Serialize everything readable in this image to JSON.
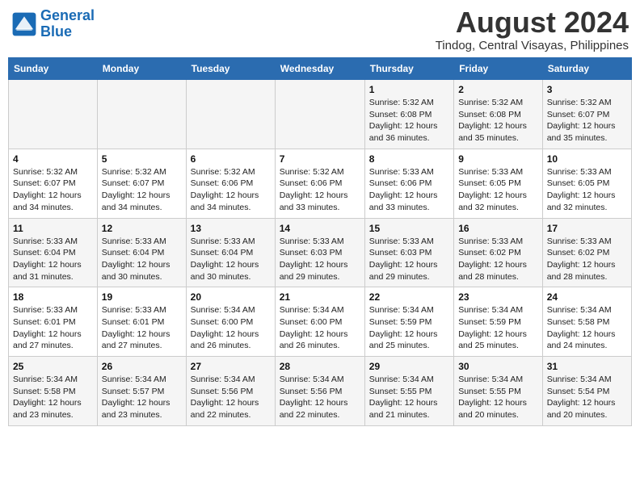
{
  "header": {
    "logo_line1": "General",
    "logo_line2": "Blue",
    "month_year": "August 2024",
    "location": "Tindog, Central Visayas, Philippines"
  },
  "weekdays": [
    "Sunday",
    "Monday",
    "Tuesday",
    "Wednesday",
    "Thursday",
    "Friday",
    "Saturday"
  ],
  "weeks": [
    [
      {
        "day": "",
        "detail": ""
      },
      {
        "day": "",
        "detail": ""
      },
      {
        "day": "",
        "detail": ""
      },
      {
        "day": "",
        "detail": ""
      },
      {
        "day": "1",
        "detail": "Sunrise: 5:32 AM\nSunset: 6:08 PM\nDaylight: 12 hours and 36 minutes."
      },
      {
        "day": "2",
        "detail": "Sunrise: 5:32 AM\nSunset: 6:08 PM\nDaylight: 12 hours and 35 minutes."
      },
      {
        "day": "3",
        "detail": "Sunrise: 5:32 AM\nSunset: 6:07 PM\nDaylight: 12 hours and 35 minutes."
      }
    ],
    [
      {
        "day": "4",
        "detail": "Sunrise: 5:32 AM\nSunset: 6:07 PM\nDaylight: 12 hours and 34 minutes."
      },
      {
        "day": "5",
        "detail": "Sunrise: 5:32 AM\nSunset: 6:07 PM\nDaylight: 12 hours and 34 minutes."
      },
      {
        "day": "6",
        "detail": "Sunrise: 5:32 AM\nSunset: 6:06 PM\nDaylight: 12 hours and 34 minutes."
      },
      {
        "day": "7",
        "detail": "Sunrise: 5:32 AM\nSunset: 6:06 PM\nDaylight: 12 hours and 33 minutes."
      },
      {
        "day": "8",
        "detail": "Sunrise: 5:33 AM\nSunset: 6:06 PM\nDaylight: 12 hours and 33 minutes."
      },
      {
        "day": "9",
        "detail": "Sunrise: 5:33 AM\nSunset: 6:05 PM\nDaylight: 12 hours and 32 minutes."
      },
      {
        "day": "10",
        "detail": "Sunrise: 5:33 AM\nSunset: 6:05 PM\nDaylight: 12 hours and 32 minutes."
      }
    ],
    [
      {
        "day": "11",
        "detail": "Sunrise: 5:33 AM\nSunset: 6:04 PM\nDaylight: 12 hours and 31 minutes."
      },
      {
        "day": "12",
        "detail": "Sunrise: 5:33 AM\nSunset: 6:04 PM\nDaylight: 12 hours and 30 minutes."
      },
      {
        "day": "13",
        "detail": "Sunrise: 5:33 AM\nSunset: 6:04 PM\nDaylight: 12 hours and 30 minutes."
      },
      {
        "day": "14",
        "detail": "Sunrise: 5:33 AM\nSunset: 6:03 PM\nDaylight: 12 hours and 29 minutes."
      },
      {
        "day": "15",
        "detail": "Sunrise: 5:33 AM\nSunset: 6:03 PM\nDaylight: 12 hours and 29 minutes."
      },
      {
        "day": "16",
        "detail": "Sunrise: 5:33 AM\nSunset: 6:02 PM\nDaylight: 12 hours and 28 minutes."
      },
      {
        "day": "17",
        "detail": "Sunrise: 5:33 AM\nSunset: 6:02 PM\nDaylight: 12 hours and 28 minutes."
      }
    ],
    [
      {
        "day": "18",
        "detail": "Sunrise: 5:33 AM\nSunset: 6:01 PM\nDaylight: 12 hours and 27 minutes."
      },
      {
        "day": "19",
        "detail": "Sunrise: 5:33 AM\nSunset: 6:01 PM\nDaylight: 12 hours and 27 minutes."
      },
      {
        "day": "20",
        "detail": "Sunrise: 5:34 AM\nSunset: 6:00 PM\nDaylight: 12 hours and 26 minutes."
      },
      {
        "day": "21",
        "detail": "Sunrise: 5:34 AM\nSunset: 6:00 PM\nDaylight: 12 hours and 26 minutes."
      },
      {
        "day": "22",
        "detail": "Sunrise: 5:34 AM\nSunset: 5:59 PM\nDaylight: 12 hours and 25 minutes."
      },
      {
        "day": "23",
        "detail": "Sunrise: 5:34 AM\nSunset: 5:59 PM\nDaylight: 12 hours and 25 minutes."
      },
      {
        "day": "24",
        "detail": "Sunrise: 5:34 AM\nSunset: 5:58 PM\nDaylight: 12 hours and 24 minutes."
      }
    ],
    [
      {
        "day": "25",
        "detail": "Sunrise: 5:34 AM\nSunset: 5:58 PM\nDaylight: 12 hours and 23 minutes."
      },
      {
        "day": "26",
        "detail": "Sunrise: 5:34 AM\nSunset: 5:57 PM\nDaylight: 12 hours and 23 minutes."
      },
      {
        "day": "27",
        "detail": "Sunrise: 5:34 AM\nSunset: 5:56 PM\nDaylight: 12 hours and 22 minutes."
      },
      {
        "day": "28",
        "detail": "Sunrise: 5:34 AM\nSunset: 5:56 PM\nDaylight: 12 hours and 22 minutes."
      },
      {
        "day": "29",
        "detail": "Sunrise: 5:34 AM\nSunset: 5:55 PM\nDaylight: 12 hours and 21 minutes."
      },
      {
        "day": "30",
        "detail": "Sunrise: 5:34 AM\nSunset: 5:55 PM\nDaylight: 12 hours and 20 minutes."
      },
      {
        "day": "31",
        "detail": "Sunrise: 5:34 AM\nSunset: 5:54 PM\nDaylight: 12 hours and 20 minutes."
      }
    ]
  ]
}
